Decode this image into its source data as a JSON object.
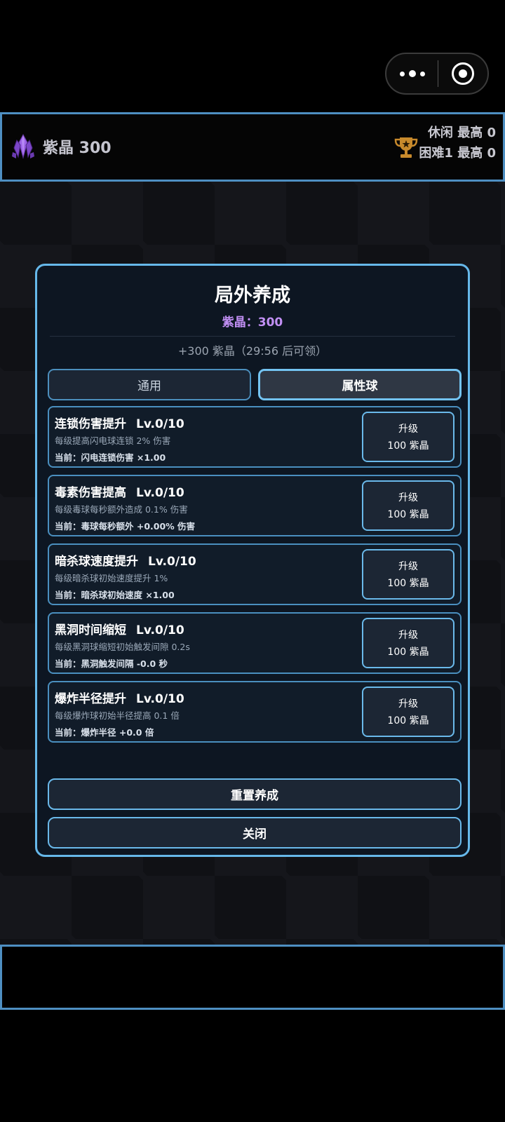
{
  "capsule": {
    "more_icon": "more-dots-icon",
    "close_icon": "target-icon"
  },
  "topbar": {
    "gem_label": "紫晶 300",
    "score_casual": "休闲 最高 0",
    "score_hard": "困难1 最高 0",
    "gem_icon": "crystal-icon",
    "trophy_icon": "trophy-icon",
    "colors": {
      "gem": "#8e59d6",
      "trophy": "#c88a2c",
      "border": "#4e8fc2"
    }
  },
  "modal": {
    "title": "局外养成",
    "balance": "紫晶：300",
    "claim": "+300 紫晶（29:56 后可领）",
    "tabs": [
      {
        "label": "通用",
        "active": false
      },
      {
        "label": "属性球",
        "active": true
      }
    ],
    "items": [
      {
        "name": "连锁伤害提升",
        "level": "Lv.0/10",
        "desc": "每级提高闪电球连锁 2% 伤害",
        "current": "当前：闪电连锁伤害 ×1.00",
        "btn_action": "升级",
        "btn_cost": "100 紫晶"
      },
      {
        "name": "毒素伤害提高",
        "level": "Lv.0/10",
        "desc": "每级毒球每秒额外造成 0.1% 伤害",
        "current": "当前：毒球每秒额外 +0.00% 伤害",
        "btn_action": "升级",
        "btn_cost": "100 紫晶"
      },
      {
        "name": "暗杀球速度提升",
        "level": "Lv.0/10",
        "desc": "每级暗杀球初始速度提升 1%",
        "current": "当前：暗杀球初始速度 ×1.00",
        "btn_action": "升级",
        "btn_cost": "100 紫晶"
      },
      {
        "name": "黑洞时间缩短",
        "level": "Lv.0/10",
        "desc": "每级黑洞球缩短初始触发间隙 0.2s",
        "current": "当前：黑洞触发间隔 -0.0 秒",
        "btn_action": "升级",
        "btn_cost": "100 紫晶"
      },
      {
        "name": "爆炸半径提升",
        "level": "Lv.0/10",
        "desc": "每级爆炸球初始半径提高 0.1 倍",
        "current": "当前：爆炸半径 +0.0 倍",
        "btn_action": "升级",
        "btn_cost": "100 紫晶"
      }
    ],
    "reset_label": "重置养成",
    "close_label": "关闭",
    "colors": {
      "accent": "#66b8ea",
      "balance": "#c290f5"
    }
  }
}
